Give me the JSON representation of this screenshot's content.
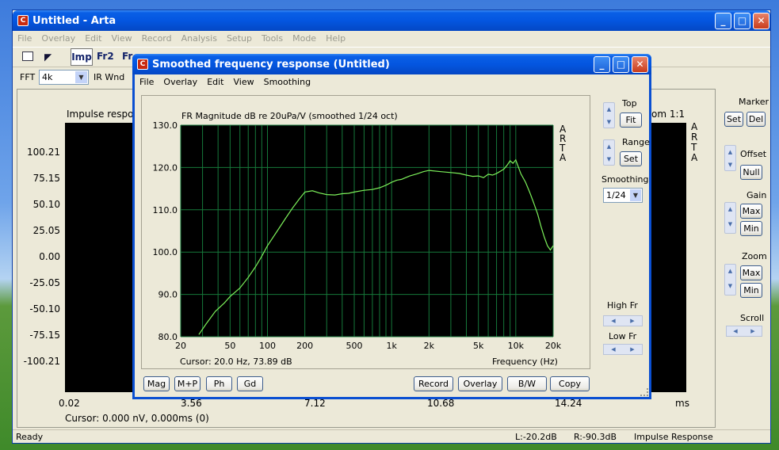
{
  "main": {
    "title": "Untitled - Arta",
    "menu": [
      "File",
      "Overlay",
      "Edit",
      "View",
      "Record",
      "Analysis",
      "Setup",
      "Tools",
      "Mode",
      "Help"
    ],
    "toolbar": {
      "imp": "Imp",
      "fr2": "Fr2",
      "fr": "Fr"
    },
    "fft_label": "FFT",
    "fft_value": "4k",
    "irwnd_label": "IR Wnd",
    "plot_title": "Impulse respo",
    "zoom_label": "om 1:1",
    "y_ticks": [
      "100.21",
      "75.15",
      "50.10",
      "25.05",
      "0.00",
      "-25.05",
      "-50.10",
      "-75.15",
      "-100.21"
    ],
    "x_ticks": [
      "0.02",
      "3.56",
      "7.12",
      "10.68",
      "14.24"
    ],
    "x_unit": "ms",
    "arta": [
      "A",
      "R",
      "T",
      "A"
    ],
    "cursor": "Cursor: 0.000 nV, 0.000ms (0)",
    "status": {
      "ready": "Ready",
      "l": "L:-20.2dB",
      "r": "R:-90.3dB",
      "mode": "Impulse Response"
    },
    "right": {
      "marker": "Marker",
      "set": "Set",
      "del": "Del",
      "offset": "Offset",
      "null": "Null",
      "gain": "Gain",
      "max": "Max",
      "min": "Min",
      "zoom": "Zoom",
      "scroll": "Scroll"
    }
  },
  "dialog": {
    "title": "Smoothed frequency response (Untitled)",
    "menu": [
      "File",
      "Overlay",
      "Edit",
      "View",
      "Smoothing"
    ],
    "side": {
      "top": "Top",
      "fit": "Fit",
      "range": "Range",
      "set": "Set",
      "smoothing": "Smoothing",
      "smoothing_value": "1/24",
      "high_fr": "High Fr",
      "low_fr": "Low Fr"
    },
    "buttons": {
      "mag": "Mag",
      "mp": "M+P",
      "ph": "Ph",
      "gd": "Gd",
      "record": "Record",
      "overlay": "Overlay",
      "bw": "B/W",
      "copy": "Copy"
    },
    "cursor": "Cursor: 20.0 Hz, 73.89 dB",
    "colors": {
      "trace": "#7cf05a",
      "grid": "#16783a"
    }
  },
  "chart_data": {
    "type": "line",
    "title": "FR Magnitude dB re 20uPa/V (smoothed 1/24 oct)",
    "xlabel": "Frequency (Hz)",
    "ylabel": "",
    "x_scale": "log",
    "xlim": [
      20,
      20000
    ],
    "ylim": [
      80,
      130
    ],
    "x_tick_labels": [
      "20",
      "50",
      "100",
      "200",
      "500",
      "1k",
      "2k",
      "5k",
      "10k",
      "20k"
    ],
    "y_tick_labels": [
      "130.0",
      "120.0",
      "110.0",
      "100.0",
      "90.0",
      "80.0"
    ],
    "legend": [
      "A",
      "R",
      "T",
      "A"
    ],
    "grid": true,
    "series": [
      {
        "x": [
          28,
          32,
          38,
          45,
          50,
          60,
          70,
          80,
          90,
          100,
          120,
          140,
          160,
          180,
          200,
          230,
          260,
          300,
          350,
          400,
          450,
          500,
          600,
          700,
          800,
          900,
          1000,
          1100,
          1200,
          1400,
          1600,
          1800,
          2000,
          2500,
          3000,
          3500,
          4000,
          4500,
          5000,
          5500,
          6000,
          6500,
          7000,
          7500,
          8000,
          8500,
          9000,
          9500,
          10000,
          11000,
          12000,
          13000,
          14000,
          15000,
          16000,
          17000,
          18000,
          19000,
          20000
        ],
        "y": [
          80.5,
          83,
          86,
          88,
          89.5,
          91.5,
          94,
          96.5,
          99,
          101.5,
          105,
          108,
          110.5,
          112.5,
          114.2,
          114.5,
          114,
          113.6,
          113.5,
          113.8,
          113.9,
          114.2,
          114.6,
          114.8,
          115.2,
          115.8,
          116.5,
          117,
          117.2,
          118,
          118.5,
          119,
          119.3,
          119,
          118.8,
          118.6,
          118.2,
          117.9,
          118,
          117.6,
          118.4,
          118.2,
          118.6,
          119.1,
          119.6,
          120.5,
          121.6,
          121,
          121.8,
          118.5,
          116.5,
          114,
          111.5,
          109,
          106,
          103.5,
          101.5,
          100.5,
          101.5
        ]
      }
    ]
  }
}
